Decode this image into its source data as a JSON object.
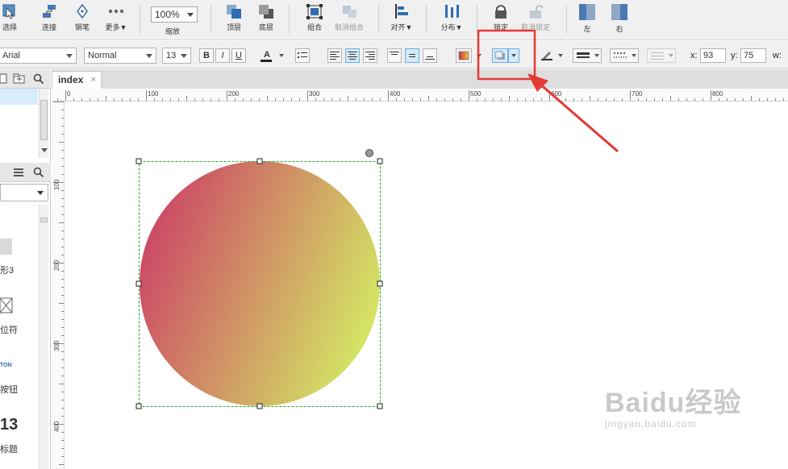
{
  "toolbar": {
    "tools": [
      {
        "label": "选择",
        "icon": "select-icon"
      },
      {
        "label": "连接",
        "icon": "connect-icon"
      },
      {
        "label": "钢笔",
        "icon": "pen-icon"
      },
      {
        "label": "更多▼",
        "icon": "more-icon"
      },
      {
        "label": "顶层",
        "icon": "bring-to-front-icon"
      },
      {
        "label": "底层",
        "icon": "send-to-back-icon"
      },
      {
        "label": "组合",
        "icon": "group-icon"
      },
      {
        "label": "取消组合",
        "icon": "ungroup-icon"
      },
      {
        "label": "对齐▼",
        "icon": "align-icon"
      },
      {
        "label": "分布▼",
        "icon": "distribute-icon"
      },
      {
        "label": "锁定",
        "icon": "lock-icon"
      },
      {
        "label": "取消锁定",
        "icon": "unlock-icon"
      },
      {
        "label": "左",
        "icon": "left-panel-icon"
      },
      {
        "label": "右",
        "icon": "right-panel-icon"
      }
    ],
    "zoom_value": "100%",
    "zoom_label": "缩放"
  },
  "format": {
    "font_family": "Arial",
    "font_style": "Normal",
    "font_size": "13",
    "bold_label": "B",
    "italic_label": "I",
    "underline_label": "U",
    "text_color_label": "A",
    "x_label": "x:",
    "x_value": "93",
    "y_label": "y:",
    "y_value": "75",
    "w_label": "w:"
  },
  "left_panel": {
    "item_labels": [
      "形3",
      "位符",
      "TON",
      "按钮",
      "13",
      "标题"
    ]
  },
  "tabs": [
    {
      "label": "index",
      "close": "×"
    }
  ],
  "ruler": {
    "h_ticks": [
      "0",
      "100",
      "200",
      "300",
      "400",
      "500",
      "600",
      "700",
      "800"
    ],
    "v_ticks": [
      "100",
      "200",
      "300",
      "400"
    ]
  },
  "shape": {
    "type": "ellipse",
    "gradient_start": "#cc4466",
    "gradient_end": "#d4ec64"
  },
  "watermark": {
    "brand": "Baidu经验",
    "url": "jingyan.baidu.com"
  },
  "colors": {
    "highlight_box": "#e53935",
    "selection": "#22aa22",
    "active_button": "#d6ebfa"
  }
}
